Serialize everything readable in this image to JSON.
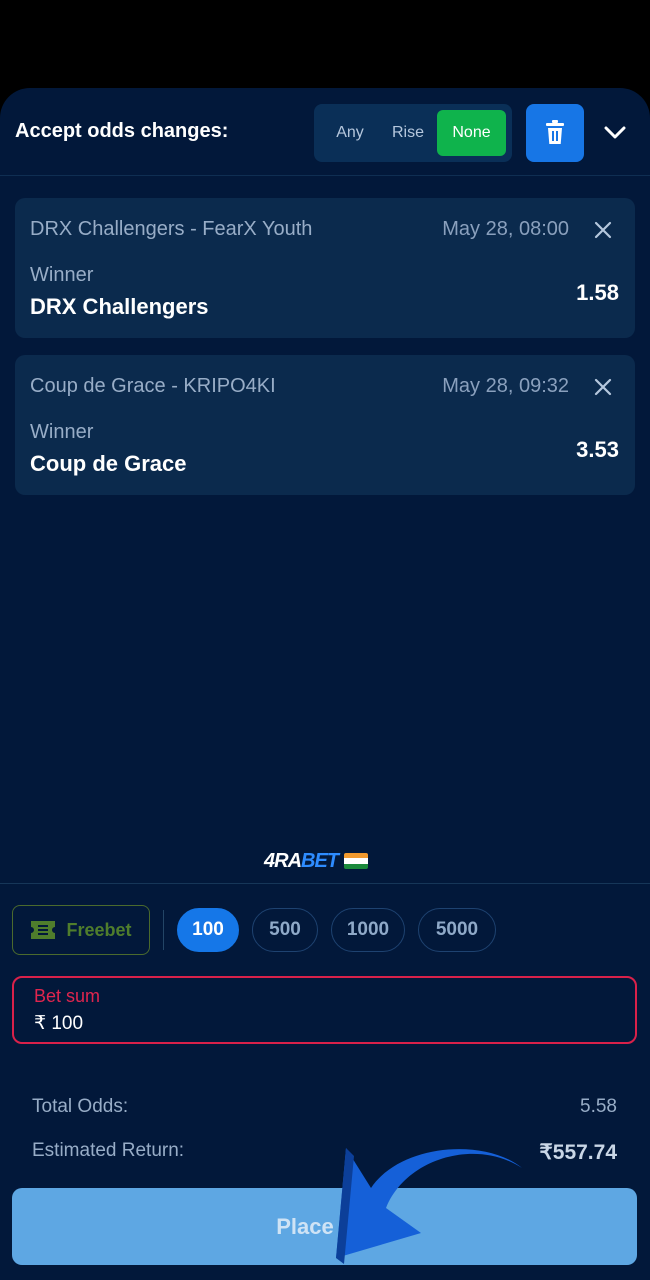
{
  "header": {
    "title": "Accept odds changes:",
    "options": [
      "Any",
      "Rise",
      "None"
    ],
    "selected": "None",
    "trash_icon": "trash-icon",
    "collapse_icon": "chevron-down-icon"
  },
  "bets": [
    {
      "match": "DRX Challengers - FearX Youth",
      "time": "May 28, 08:00",
      "market": "Winner",
      "pick": "DRX Challengers",
      "odds": "1.58"
    },
    {
      "match": "Coup de Grace - KRIPO4KI",
      "time": "May 28, 09:32",
      "market": "Winner",
      "pick": "Coup de Grace",
      "odds": "3.53"
    }
  ],
  "logo": {
    "text_a": "4RA",
    "text_b": "BET"
  },
  "stake": {
    "freebet_label": "Freebet",
    "chips": [
      "100",
      "500",
      "1000",
      "5000"
    ],
    "selected_chip": "100",
    "bet_sum_label": "Bet sum",
    "bet_sum_value": "₹  100"
  },
  "summary": {
    "total_odds_label": "Total Odds:",
    "total_odds_value": "5.58",
    "est_return_label": "Estimated Return:",
    "est_return_value": "₹557.74"
  },
  "place_bet_label": "Place bet",
  "colors": {
    "accent": "#1577e8",
    "success": "#0fb34c",
    "error": "#d9214a",
    "background": "#02183a"
  }
}
